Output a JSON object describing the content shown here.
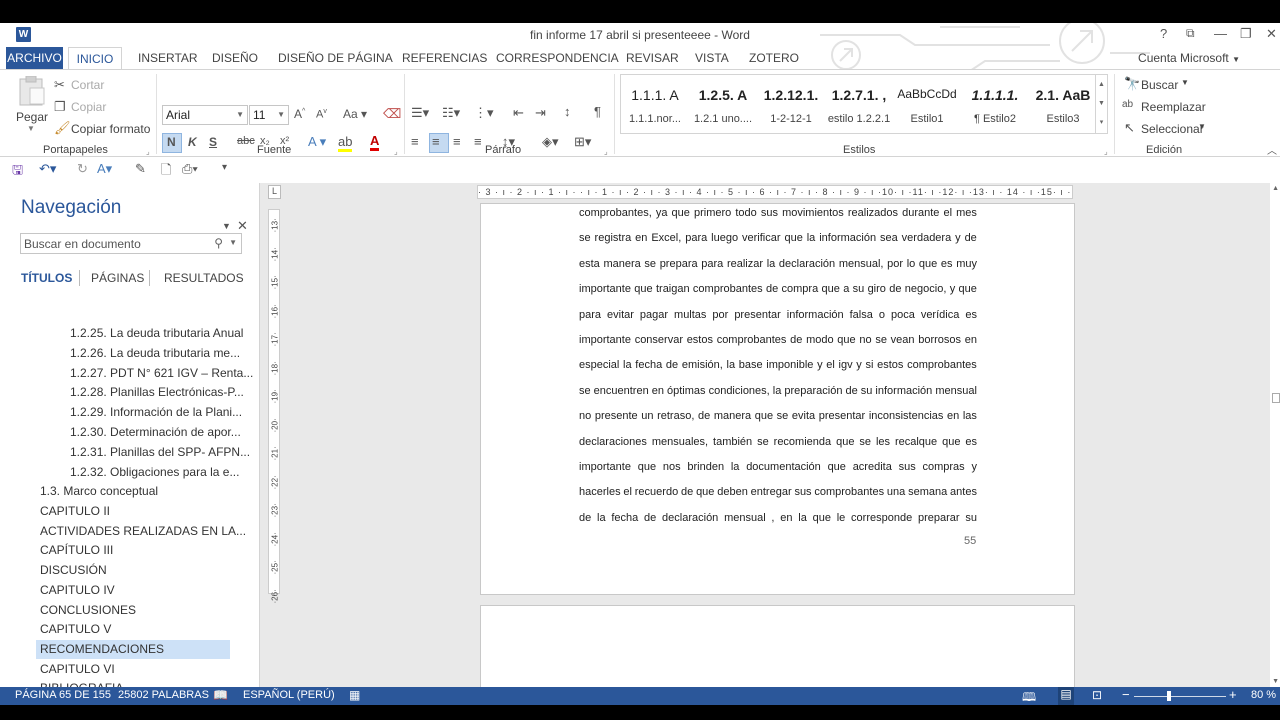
{
  "window": {
    "title": "fin informe 17 abril si presenteeee - Word",
    "logo": "W",
    "help": "?",
    "restore_ribbon": "⧉",
    "minimize": "—",
    "maximize": "❐",
    "close": "✕"
  },
  "tabs": [
    "ARCHIVO",
    "INICIO",
    "INSERTAR",
    "DISEÑO",
    "DISEÑO DE PÁGINA",
    "REFERENCIAS",
    "CORRESPONDENCIA",
    "REVISAR",
    "VISTA",
    "ZOTERO"
  ],
  "account": "Cuenta Microsoft",
  "clipboard": {
    "paste": "Pegar",
    "cut": "Cortar",
    "copy": "Copiar",
    "format_painter": "Copiar formato",
    "label": "Portapapeles"
  },
  "font": {
    "name": "Arial",
    "size": "11",
    "bold": "N",
    "italic": "K",
    "underline": "S",
    "label": "Fuente",
    "case": "Aa"
  },
  "paragraph": {
    "label": "Párrafo"
  },
  "styles": {
    "label": "Estilos",
    "items": [
      {
        "preview": "1.1.1.  A",
        "name": "1.1.1.nor..."
      },
      {
        "preview": "1.2.5.  A",
        "name": "1.2.1 uno...."
      },
      {
        "preview": "1.2.12.1.",
        "name": "1-2-12-1"
      },
      {
        "preview": "1.2.7.1. ,",
        "name": "estilo 1.2.2.1"
      },
      {
        "preview": "AaBbCcDd",
        "name": "Estilo1"
      },
      {
        "preview": "1.1.1.1.",
        "name": "¶ Estilo2"
      },
      {
        "preview": "2.1.  AaB",
        "name": "Estilo3"
      }
    ]
  },
  "editing": {
    "find": "Buscar",
    "replace": "Reemplazar",
    "select": "Seleccionar",
    "label": "Edición"
  },
  "nav": {
    "title": "Navegación",
    "search_placeholder": "Buscar en documento",
    "tabs": [
      "TÍTULOS",
      "PÁGINAS",
      "RESULTADOS"
    ],
    "items": [
      {
        "text": "1.2.25. La deuda tributaria Anual",
        "level": 3
      },
      {
        "text": "1.2.26. La deuda tributaria me...",
        "level": 3
      },
      {
        "text": "1.2.27. PDT N° 621 IGV – Renta...",
        "level": 3
      },
      {
        "text": "1.2.28. Planillas Electrónicas-P...",
        "level": 3
      },
      {
        "text": "1.2.29. Información de la Plani...",
        "level": 3
      },
      {
        "text": "1.2.30. Determinación de apor...",
        "level": 3
      },
      {
        "text": "1.2.31. Planillas del SPP- AFPN...",
        "level": 3
      },
      {
        "text": "1.2.32. Obligaciones para la e...",
        "level": 3
      },
      {
        "text": "1.3. Marco conceptual",
        "level": 1
      },
      {
        "text": "CAPITULO II",
        "level": 1
      },
      {
        "text": "ACTIVIDADES REALIZADAS     EN LA...",
        "level": 1
      },
      {
        "text": "CAPÍTULO III",
        "level": 1
      },
      {
        "text": "DISCUSIÓN",
        "level": 1
      },
      {
        "text": "CAPITULO IV",
        "level": 1
      },
      {
        "text": "CONCLUSIONES",
        "level": 1
      },
      {
        "text": "CAPITULO V",
        "level": 1
      },
      {
        "text": "RECOMENDACIONES",
        "level": 1,
        "selected": true
      },
      {
        "text": "CAPITULO VI",
        "level": 1
      },
      {
        "text": "BIBLIOGRAFIA",
        "level": 1
      }
    ]
  },
  "ruler": {
    "horizontal": "· 3 · ı · 2 · ı · 1 · ı ·  · ı · 1 · ı · 2 · ı · 3 · ı · 4 · ı · 5 · ı · 6 · ı · 7 · ı · 8 · ı · 9 · ı ·10· ı ·11· ı ·12· ı ·13· ı · 14 · ı ·15· ı ·16· ı ·17·",
    "corner": "L"
  },
  "document": {
    "lines": [
      "comprobantes, ya que primero todo sus movimientos realizados durante el mes",
      "se registra en Excel, para luego verificar que la información sea verdadera y de",
      "esta manera se prepara para realizar la declaración mensual,  por lo que es muy",
      "importante que traigan comprobantes de  compra que a su giro de negocio, y que",
      "para evitar pagar multas por presentar información falsa o poca verídica  es",
      "importante conservar estos comprobantes de modo que no se vean borrosos en",
      "especial la fecha de emisión, la base imponible y el igv y si estos comprobantes",
      "se encuentren en óptimas condiciones, la preparación de su información mensual",
      "no presente un retraso, de manera que se evita presentar inconsistencias en las",
      "declaraciones mensuales, también se recomienda que se les recalque que es",
      "importante que nos brinden la documentación que acredita sus compras y",
      "hacerles el recuerdo de que deben entregar sus comprobantes una semana antes",
      "de la fecha de declaración mensual , en la que  le corresponde preparar su"
    ],
    "page_number": "55"
  },
  "status": {
    "page": "PÁGINA 65 DE 155",
    "words": "25802 PALABRAS",
    "language": "ESPAÑOL (PERÚ)",
    "zoom": "80 %",
    "zoom_minus": "−",
    "zoom_plus": "+"
  },
  "colors": {
    "accent": "#2b579a",
    "selection": "#cde1f7"
  }
}
